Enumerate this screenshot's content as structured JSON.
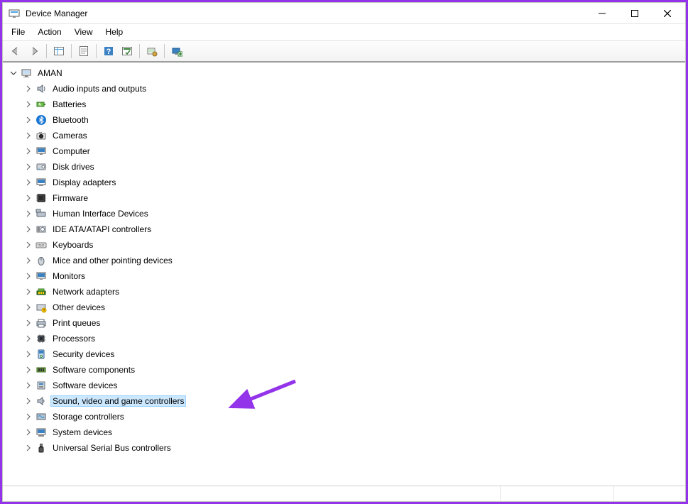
{
  "window": {
    "title": "Device Manager"
  },
  "menu": {
    "file": "File",
    "action": "Action",
    "view": "View",
    "help": "Help"
  },
  "tree": {
    "root": "AMAN",
    "items": [
      "Audio inputs and outputs",
      "Batteries",
      "Bluetooth",
      "Cameras",
      "Computer",
      "Disk drives",
      "Display adapters",
      "Firmware",
      "Human Interface Devices",
      "IDE ATA/ATAPI controllers",
      "Keyboards",
      "Mice and other pointing devices",
      "Monitors",
      "Network adapters",
      "Other devices",
      "Print queues",
      "Processors",
      "Security devices",
      "Software components",
      "Software devices",
      "Sound, video and game controllers",
      "Storage controllers",
      "System devices",
      "Universal Serial Bus controllers"
    ],
    "selected_index": 20
  },
  "annotation": {
    "color": "#9333ea"
  }
}
